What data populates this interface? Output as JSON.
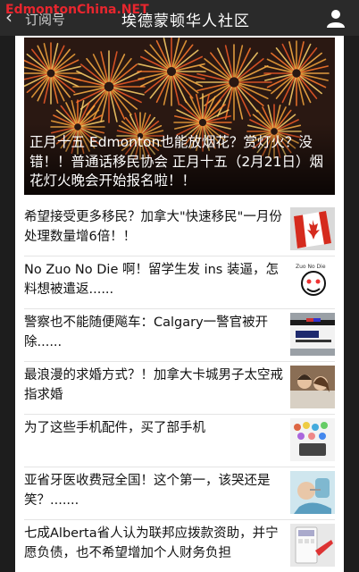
{
  "nav": {
    "back_label": "订阅号",
    "title": "埃德蒙顿华人社区",
    "watermark": "EdmontonChina.NET"
  },
  "hero": {
    "headline": "正月十五 Edmonton也能放烟花？赏灯火？没错！！普通话移民协会 正月十五（2月21日）烟花灯火晚会开始报名啦！！"
  },
  "articles": [
    {
      "title": "希望接受更多移民？加拿大\"快速移民\"一月份处理数量增6倍！！",
      "thumb": "canada-flag-thumbnail"
    },
    {
      "title": "No Zuo No Die 啊！留学生发 ins 装逼，怎料想被遣返......",
      "thumb": "no-zuo-no-die-thumbnail"
    },
    {
      "title": "警察也不能随便飚车：Calgary一警官被开除......",
      "thumb": "police-car-thumbnail"
    },
    {
      "title": "最浪漫的求婚方式？！加拿大卡城男子太空戒指求婚",
      "thumb": "couple-thumbnail"
    },
    {
      "title": "为了这些手机配件，买了部手机",
      "thumb": "phone-accessory-thumbnail"
    },
    {
      "title": "亚省牙医收费冠全国！这个第一，该哭还是笑？.......",
      "thumb": "dentist-thumbnail"
    },
    {
      "title": "七成Alberta省人认为联邦应拨款资助，并宁愿负债，也不希望增加个人财务负担",
      "thumb": "calculator-thumbnail"
    }
  ]
}
